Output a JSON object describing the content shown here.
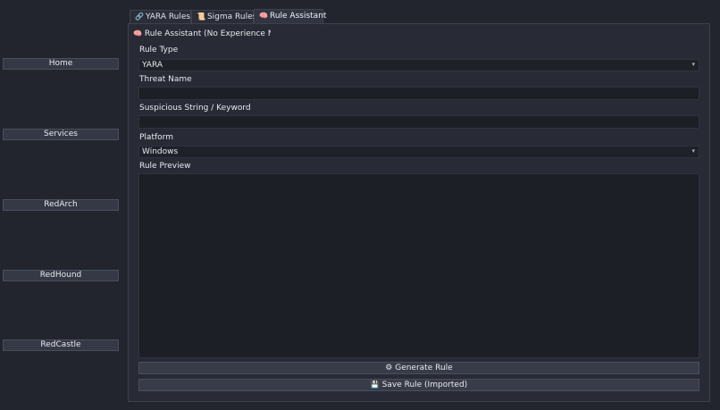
{
  "sidebar": {
    "items": [
      {
        "label": "Home"
      },
      {
        "label": "Services"
      },
      {
        "label": "RedArch"
      },
      {
        "label": "RedHound"
      },
      {
        "label": "RedCastle"
      }
    ]
  },
  "tabs": [
    {
      "icon": "🔗",
      "label": "YARA Rules"
    },
    {
      "icon": "📜",
      "label": "Sigma Rules"
    },
    {
      "icon": "🧠",
      "label": "Rule Assistant"
    }
  ],
  "active_tab": "Rule Assistant",
  "assistant": {
    "title_icon": "🧠",
    "title": "Rule Assistant (No Experience Needed)",
    "rule_type_label": "Rule Type",
    "rule_type_value": "YARA",
    "threat_name_label": "Threat Name",
    "threat_name_value": "",
    "suspicious_label": "Suspicious String / Keyword",
    "suspicious_value": "",
    "platform_label": "Platform",
    "platform_value": "Windows",
    "preview_label": "Rule Preview",
    "preview_value": "",
    "generate_icon": "⚙",
    "generate_label": "Generate Rule",
    "save_icon": "💾",
    "save_label": "Save Rule (Imported)"
  },
  "colors": {
    "background": "#22252e",
    "panel": "#282b35",
    "field": "#1d1f26",
    "button": "#383c48"
  }
}
